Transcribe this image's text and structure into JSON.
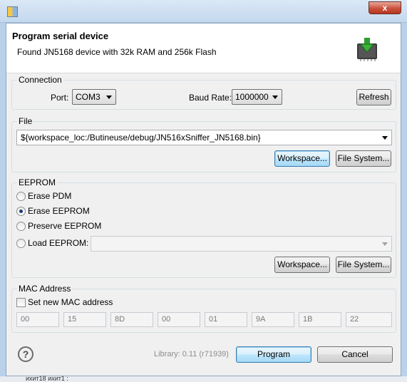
{
  "window": {
    "close_label": "x"
  },
  "header": {
    "title": "Program serial device",
    "subtitle": "Found JN5168 device with 32k RAM and 256k Flash"
  },
  "connection": {
    "group_label": "Connection",
    "port_label": "Port:",
    "port_value": "COM3",
    "baud_label": "Baud Rate:",
    "baud_value": "1000000",
    "refresh_label": "Refresh"
  },
  "file": {
    "group_label": "File",
    "path_value": "${workspace_loc:/Butineuse/debug/JN516xSniffer_JN5168.bin}",
    "workspace_label": "Workspace...",
    "filesystem_label": "File System..."
  },
  "eeprom": {
    "group_label": "EEPROM",
    "options": [
      "Erase PDM",
      "Erase EEPROM",
      "Preserve EEPROM",
      "Load EEPROM:"
    ],
    "selected": "Erase EEPROM",
    "load_value": "",
    "workspace_label": "Workspace...",
    "filesystem_label": "File System..."
  },
  "mac": {
    "group_label": "MAC Address",
    "set_label": "Set new MAC address",
    "set_checked": false,
    "bytes": [
      "00",
      "15",
      "8D",
      "00",
      "01",
      "9A",
      "1B",
      "22"
    ]
  },
  "footer": {
    "help_label": "?",
    "library_text": "Library: 0.11 (r71939)",
    "program_label": "Program",
    "cancel_label": "Cancel"
  },
  "behind": {
    "text": "ихит18  ихит1 :"
  },
  "icons": [
    "app-icon",
    "close-icon",
    "chip-download-icon",
    "help-icon",
    "dropdown-arrow-icon"
  ]
}
